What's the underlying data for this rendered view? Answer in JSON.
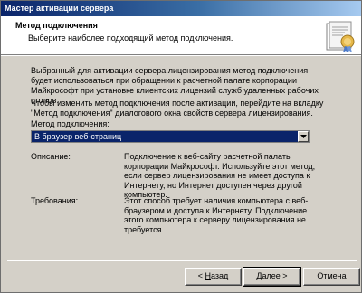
{
  "window": {
    "title": "Мастер активации сервера"
  },
  "header": {
    "title": "Метод подключения",
    "subtitle": "Выберите наиболее подходящий метод подключения."
  },
  "intro": {
    "p1": "Выбранный для активации сервера лицензирования метод подключения будет использоваться при обращении к расчетной палате корпорации Майкрософт при установке клиентских лицензий служб удаленных рабочих столов.",
    "p2": "Чтобы изменить метод подключения после активации, перейдите на вкладку \"Метод подключения\" диалогового окна свойств сервера лицензирования."
  },
  "method": {
    "label_prefix": "М",
    "label_rest": "етод подключения:",
    "selected": "В браузер веб-страниц"
  },
  "description": {
    "label": "Описание:",
    "text": "Подключение к веб-сайту расчетной палаты корпорации Майкрософт. Используйте этот метод, если сервер лицензирования не имеет доступа к Интернету, но Интернет доступен через другой компьютер."
  },
  "requirements": {
    "label": "Требования:",
    "text": "Этот способ требует наличия компьютера с веб-браузером и доступа к Интернету. Подключение этого компьютера к серверу лицензирования не требуется."
  },
  "buttons": {
    "back_prefix": "< ",
    "back_u": "Н",
    "back_rest": "азад",
    "next_u": "Д",
    "next_rest": "алее >",
    "cancel": "Отмена"
  },
  "icons": {
    "header": "certificate-icon",
    "dropdown": "chevron-down-icon"
  }
}
